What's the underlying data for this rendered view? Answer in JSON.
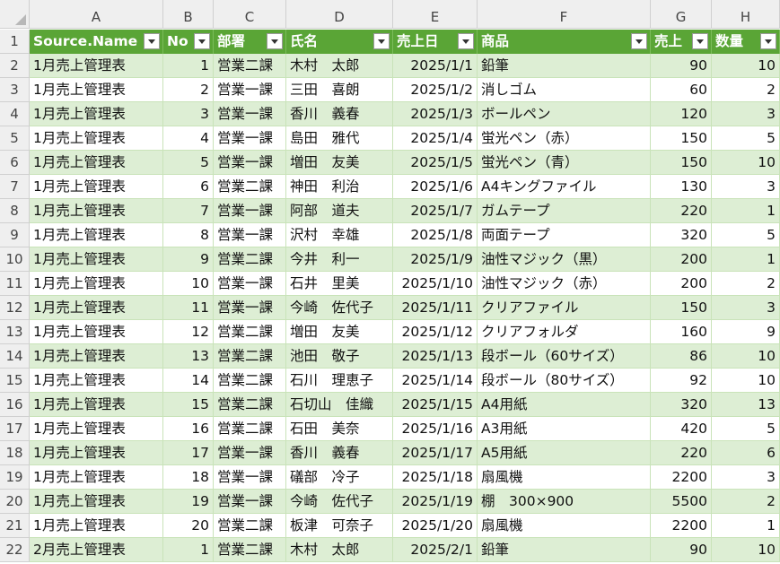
{
  "spreadsheet": {
    "column_letters": [
      "A",
      "B",
      "C",
      "D",
      "E",
      "F",
      "G",
      "H"
    ],
    "row_numbers": [
      "1",
      "2",
      "3",
      "4",
      "5",
      "6",
      "7",
      "8",
      "9",
      "10",
      "11",
      "12",
      "13",
      "14",
      "15",
      "16",
      "17",
      "18",
      "19",
      "20",
      "21",
      "22"
    ],
    "headers": [
      "Source.Name",
      "No",
      "部署",
      "氏名",
      "売上日",
      "商品",
      "売上",
      "数量"
    ],
    "filter_icon": "filter-dropdown-icon",
    "colors": {
      "header_green": "#5aa536",
      "band_green": "#ddeed4",
      "grid_line": "#c9e3b9"
    },
    "rows": [
      [
        "1月売上管理表",
        "1",
        "営業二課",
        "木村　太郎",
        "2025/1/1",
        "鉛筆",
        "90",
        "10"
      ],
      [
        "1月売上管理表",
        "2",
        "営業一課",
        "三田　喜朗",
        "2025/1/2",
        "消しゴム",
        "60",
        "2"
      ],
      [
        "1月売上管理表",
        "3",
        "営業一課",
        "香川　義春",
        "2025/1/3",
        "ボールペン",
        "120",
        "3"
      ],
      [
        "1月売上管理表",
        "4",
        "営業一課",
        "島田　雅代",
        "2025/1/4",
        "蛍光ペン（赤）",
        "150",
        "5"
      ],
      [
        "1月売上管理表",
        "5",
        "営業一課",
        "増田　友美",
        "2025/1/5",
        "蛍光ペン（青）",
        "150",
        "10"
      ],
      [
        "1月売上管理表",
        "6",
        "営業二課",
        "神田　利治",
        "2025/1/6",
        "A4キングファイル",
        "130",
        "3"
      ],
      [
        "1月売上管理表",
        "7",
        "営業一課",
        "阿部　道夫",
        "2025/1/7",
        "ガムテープ",
        "220",
        "1"
      ],
      [
        "1月売上管理表",
        "8",
        "営業一課",
        "沢村　幸雄",
        "2025/1/8",
        "両面テープ",
        "320",
        "5"
      ],
      [
        "1月売上管理表",
        "9",
        "営業二課",
        "今井　利一",
        "2025/1/9",
        "油性マジック（黒）",
        "200",
        "1"
      ],
      [
        "1月売上管理表",
        "10",
        "営業一課",
        "石井　里美",
        "2025/1/10",
        "油性マジック（赤）",
        "200",
        "2"
      ],
      [
        "1月売上管理表",
        "11",
        "営業一課",
        "今崎　佐代子",
        "2025/1/11",
        "クリアファイル",
        "150",
        "3"
      ],
      [
        "1月売上管理表",
        "12",
        "営業二課",
        "増田　友美",
        "2025/1/12",
        "クリアフォルダ",
        "160",
        "9"
      ],
      [
        "1月売上管理表",
        "13",
        "営業二課",
        "池田　敬子",
        "2025/1/13",
        "段ボール（60サイズ）",
        "86",
        "10"
      ],
      [
        "1月売上管理表",
        "14",
        "営業二課",
        "石川　理恵子",
        "2025/1/14",
        "段ボール（80サイズ）",
        "92",
        "10"
      ],
      [
        "1月売上管理表",
        "15",
        "営業二課",
        "石切山　佳織",
        "2025/1/15",
        "A4用紙",
        "320",
        "13"
      ],
      [
        "1月売上管理表",
        "16",
        "営業二課",
        "石田　美奈",
        "2025/1/16",
        "A3用紙",
        "420",
        "5"
      ],
      [
        "1月売上管理表",
        "17",
        "営業一課",
        "香川　義春",
        "2025/1/17",
        "A5用紙",
        "220",
        "6"
      ],
      [
        "1月売上管理表",
        "18",
        "営業一課",
        "礒部　冷子",
        "2025/1/18",
        "扇風機",
        "2200",
        "3"
      ],
      [
        "1月売上管理表",
        "19",
        "営業一課",
        "今崎　佐代子",
        "2025/1/19",
        "棚　300×900",
        "5500",
        "2"
      ],
      [
        "1月売上管理表",
        "20",
        "営業二課",
        "板津　可奈子",
        "2025/1/20",
        "扇風機",
        "2200",
        "1"
      ],
      [
        "2月売上管理表",
        "1",
        "営業二課",
        "木村　太郎",
        "2025/2/1",
        "鉛筆",
        "90",
        "10"
      ]
    ]
  }
}
